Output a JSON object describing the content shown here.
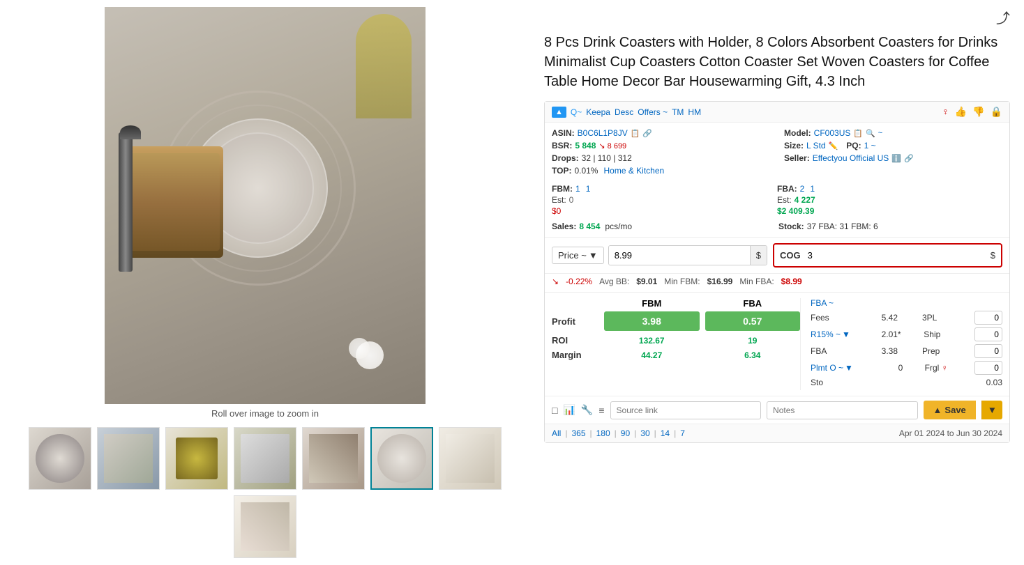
{
  "product": {
    "title": "8 Pcs Drink Coasters with Holder, 8 Colors Absorbent Coasters for Drinks Minimalist Cup Coasters Cotton Coaster Set Woven Coasters for Coffee Table Home Decor Bar Housewarming Gift, 4.3 Inch",
    "roll_over_text": "Roll over image to zoom in"
  },
  "header": {
    "keepa_label": "▲ Q~",
    "desc": "Keepa",
    "desc_label": "Desc",
    "offers_label": "Offers ~",
    "tm_label": "TM",
    "hm_label": "HM",
    "share_icon": "⤴"
  },
  "product_info": {
    "asin_label": "ASIN:",
    "asin_value": "B0C6L1P8JV",
    "model_label": "Model:",
    "model_value": "CF003US",
    "bsr_label": "BSR:",
    "bsr_value": "5 848",
    "bsr_drop": "↘ 8 699",
    "size_label": "Size:",
    "size_value": "L Std",
    "pq_label": "PQ:",
    "pq_value": "1 ~",
    "drops_label": "Drops:",
    "drops_value": "32 | 110 | 312",
    "seller_label": "Seller:",
    "seller_value": "Effectyou Official US",
    "top_label": "TOP:",
    "top_value": "0.01%",
    "top_category": "Home & Kitchen",
    "fbm_label": "FBM:",
    "fbm_val1": "1",
    "fbm_val2": "1",
    "fba_label": "FBA:",
    "fba_val1": "2",
    "fba_val2": "1",
    "sales_label": "Sales:",
    "sales_value": "8 454",
    "sales_unit": "pcs/mo",
    "est_fbm_label": "Est:",
    "est_fbm_val": "0",
    "est_fbm_dollars": "$0",
    "est_fba_label": "Est:",
    "est_fba_val": "4 227",
    "est_fba_dollars": "$2 409.39",
    "stock_label": "Stock:",
    "stock_value": "37 FBA: 31 FBM: 6"
  },
  "pricing": {
    "price_label": "Price ~",
    "price_value": "8.99",
    "price_currency": "$",
    "cog_label": "COG",
    "cog_value": "3",
    "cog_currency": "$"
  },
  "bb_row": {
    "drop_arrow": "↘",
    "pct": "-0.22%",
    "avg_bb_label": "Avg BB:",
    "avg_bb_val": "$9.01",
    "min_fbm_label": "Min FBM:",
    "min_fbm_val": "$16.99",
    "min_fba_label": "Min FBA:",
    "min_fba_val": "$8.99"
  },
  "calc": {
    "fbm_header": "FBM",
    "fba_header": "FBA",
    "fba_select": "FBA ~",
    "profit_label": "Profit",
    "profit_fbm": "3.98",
    "profit_fba": "0.57",
    "roi_label": "ROI",
    "roi_fbm": "132.67",
    "roi_fba": "19",
    "roi_fbm_sub": "44.27",
    "roi_fba_sub": "6.34",
    "margin_label": "Margin"
  },
  "fees": {
    "fees_label": "Fees",
    "fees_val": "5.42",
    "tpl_label": "3PL",
    "tpl_val": "0",
    "r15_label": "R15% ~",
    "r15_val": "2.01*",
    "ship_label": "Ship",
    "ship_val": "0",
    "fba_label": "FBA",
    "fba_val": "3.38",
    "prep_label": "Prep",
    "prep_val": "0",
    "plmt_label": "Plmt O ~",
    "plmt_val": "0",
    "frgl_label": "Frgl",
    "frgl_icon": "♀",
    "frgl_val": "0",
    "sto_label": "Sto",
    "sto_val": "0.03"
  },
  "bottom": {
    "source_link_placeholder": "Source link",
    "notes_placeholder": "Notes",
    "save_label": "Save",
    "save_icon": "▲"
  },
  "date_footer": {
    "all_label": "All",
    "d365_label": "365",
    "d180_label": "180",
    "d90_label": "90",
    "d30_label": "30",
    "d14_label": "14",
    "d7_label": "7",
    "date_range": "Apr 01 2024 to Jun 30 2024"
  },
  "thumbnails": [
    {
      "id": 1,
      "class": "t1",
      "selected": false
    },
    {
      "id": 2,
      "class": "t2",
      "selected": false
    },
    {
      "id": 3,
      "class": "t3",
      "selected": false
    },
    {
      "id": 4,
      "class": "t4",
      "selected": false
    },
    {
      "id": 5,
      "class": "t5",
      "selected": false
    },
    {
      "id": 6,
      "class": "t6",
      "selected": true
    },
    {
      "id": 7,
      "class": "t7",
      "selected": false
    },
    {
      "id": 8,
      "class": "t8",
      "selected": false
    }
  ]
}
